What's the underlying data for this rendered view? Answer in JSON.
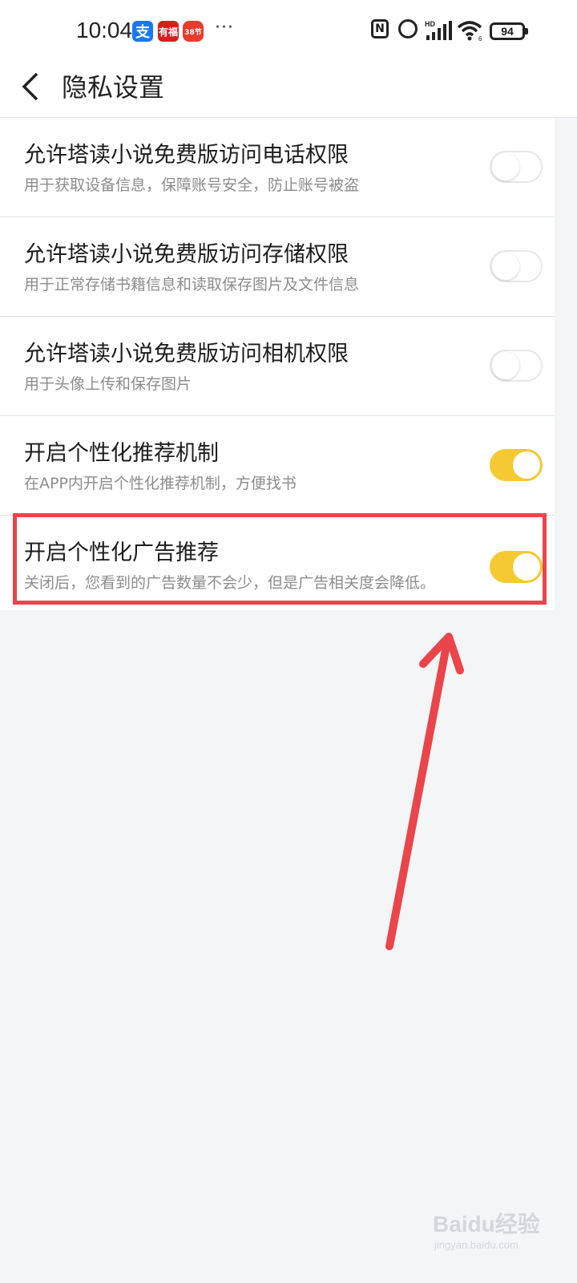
{
  "status_bar": {
    "time": "10:04",
    "app_badges": [
      "支",
      "有福",
      "38节"
    ],
    "overflow": "···",
    "nfc_label": "N",
    "signal_label": "HD",
    "battery": "94"
  },
  "header": {
    "title": "隐私设置"
  },
  "settings": [
    {
      "title": "允许塔读小说免费版访问电话权限",
      "desc": "用于获取设备信息，保障账号安全，防止账号被盗",
      "enabled": false
    },
    {
      "title": "允许塔读小说免费版访问存储权限",
      "desc": "用于正常存储书籍信息和读取保存图片及文件信息",
      "enabled": false
    },
    {
      "title": "允许塔读小说免费版访问相机权限",
      "desc": "用于头像上传和保存图片",
      "enabled": false
    },
    {
      "title": "开启个性化推荐机制",
      "desc": "在APP内开启个性化推荐机制，方便找书",
      "enabled": true
    },
    {
      "title": "开启个性化广告推荐",
      "desc": "关闭后，您看到的广告数量不会少，但是广告相关度会降低。",
      "enabled": true
    }
  ],
  "watermark": {
    "brand": "Baidu经验",
    "url": "jingyan.baidu.com"
  },
  "colors": {
    "toggle_on": "#f5c932",
    "annotation": "#e9454a"
  }
}
